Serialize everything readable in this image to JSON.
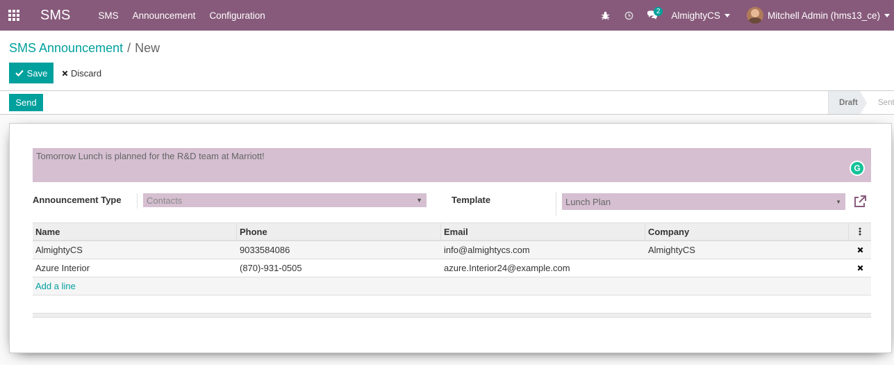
{
  "navbar": {
    "app_name": "SMS",
    "menu": [
      "SMS",
      "Announcement",
      "Configuration"
    ],
    "message_count": "2",
    "company": "AlmightyCS",
    "user": "Mitchell Admin (hms13_ce)",
    "bg_color": "#875a7b"
  },
  "breadcrumb": {
    "parent": "SMS Announcement",
    "separator": "/",
    "current": "New"
  },
  "buttons": {
    "save": "Save",
    "discard": "Discard",
    "send": "Send"
  },
  "status": {
    "stages": [
      "Draft",
      "Sent"
    ],
    "active": "Draft"
  },
  "form": {
    "message": "Tomorrow Lunch is planned for the R&D team at Marriott!",
    "announcement_type_label": "Announcement Type",
    "announcement_type_value": "Contacts",
    "template_label": "Template",
    "template_value": "Lunch Plan"
  },
  "table": {
    "headers": [
      "Name",
      "Phone",
      "Email",
      "Company"
    ],
    "rows": [
      {
        "name": "AlmightyCS",
        "phone": "9033584086",
        "email": "info@almightycs.com",
        "company": "AlmightyCS"
      },
      {
        "name": "Azure Interior",
        "phone": "(870)-931-0505",
        "email": "azure.Interior24@example.com",
        "company": ""
      }
    ],
    "add_line": "Add a line"
  },
  "accent_color": "#00a09d"
}
